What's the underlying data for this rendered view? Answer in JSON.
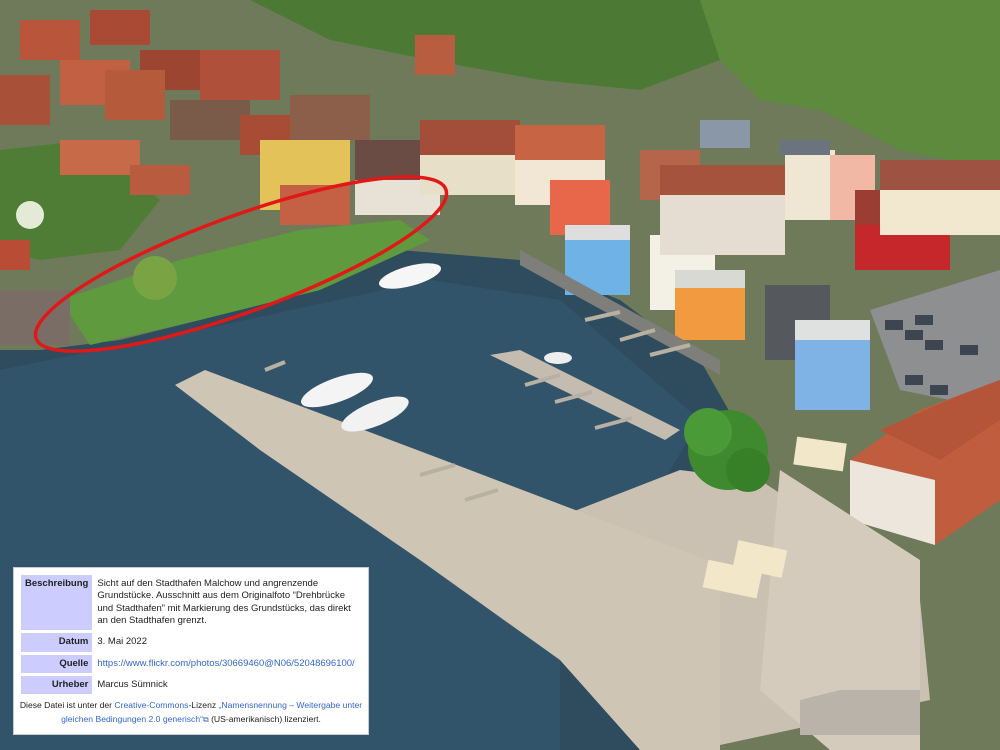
{
  "info": {
    "description_label": "Beschreibung",
    "description_text": "Sicht auf den Stadthafen Malchow und angrenzende Grundstücke. Ausschnitt aus dem Originalfoto “Drehbrücke und Stadthafen” mit Markierung des Grundstücks, das direkt an den Stadthafen grenzt.",
    "date_label": "Datum",
    "date_value": "3. Mai 2022",
    "source_label": "Quelle",
    "source_value": "https://www.flickr.com/photos/30669460@N06/52048696100/",
    "author_label": "Urheber",
    "author_value": "Marcus Sümnick"
  },
  "license": {
    "prefix": "Diese Datei ist unter der ",
    "cc_link": "Creative-Commons",
    "middle": "-Lizenz ",
    "license_link": "„Namensnennung – Weitergabe unter gleichen Bedingungen 2.0 generisch“",
    "suffix": " (US-amerikanisch) lizenziert."
  },
  "colors": {
    "water": "#2c4a5e",
    "roof": "#c0573b",
    "pier": "#cfc6b6",
    "tree": "#3f8a2f",
    "marker": "#e01818",
    "label_bg": "#ccccff",
    "link": "#3366cc"
  }
}
